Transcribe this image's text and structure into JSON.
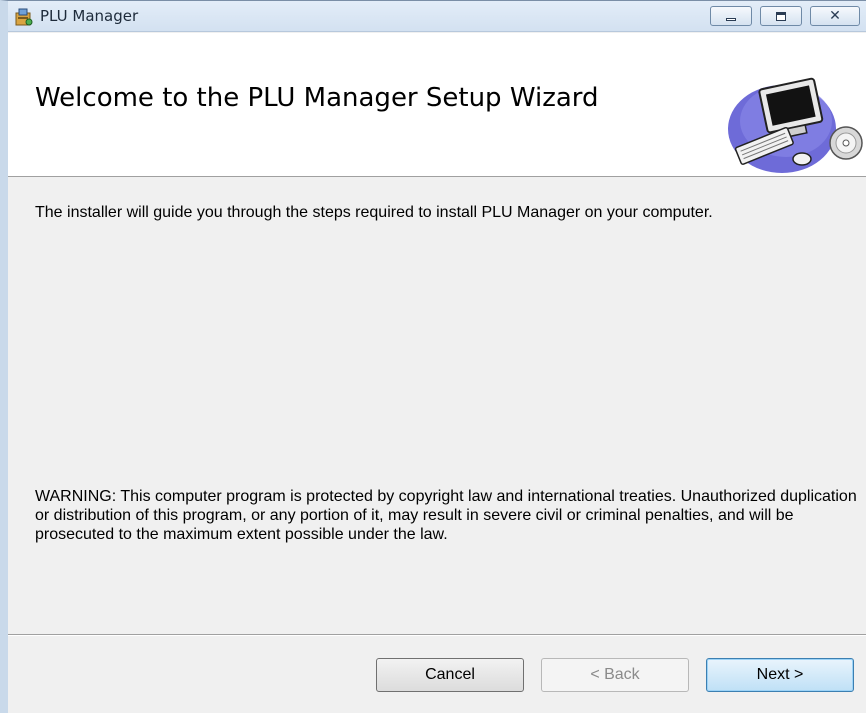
{
  "window": {
    "title": "PLU Manager",
    "app_icon": "installer-icon",
    "controls": {
      "minimize": "minimize-icon",
      "maximize": "maximize-icon",
      "close": "close-icon",
      "close_glyph": "✕"
    }
  },
  "banner": {
    "title": "Welcome to the PLU Manager Setup Wizard",
    "art_icon": "computer-cd-illustration"
  },
  "main": {
    "intro_text": "The installer will guide you through the steps required to install PLU Manager on your computer.",
    "warning_text": "WARNING: This computer program is protected by copyright law and international treaties. Unauthorized duplication or distribution of this program, or any portion of it, may result in severe civil or criminal penalties, and will be prosecuted to the maximum extent possible under the law."
  },
  "buttons": {
    "cancel_label": "Cancel",
    "back_label": "< Back",
    "next_label": "Next >"
  }
}
